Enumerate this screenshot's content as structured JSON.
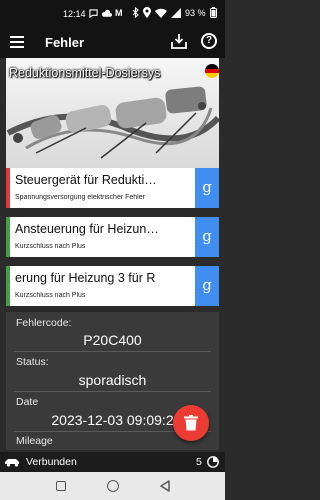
{
  "status_bar": {
    "time": "12:14",
    "battery": "93 %",
    "icons": [
      "chat-icon",
      "cloud-icon",
      "gmail-icon",
      "bluetooth-icon",
      "location-icon",
      "wifi-icon",
      "signal-icon",
      "battery-icon"
    ]
  },
  "app_bar": {
    "title": "Fehler",
    "icons": [
      "menu-icon",
      "download-icon",
      "help-icon"
    ]
  },
  "hero": {
    "title": "Reduktionsmittel-Dosiersys"
  },
  "fault_cards": [
    {
      "title": "Steuergerät für Redukti…",
      "subtitle": "Spannungsversorgung elektrischer Fehler",
      "accent": "#e53935",
      "action": "g"
    },
    {
      "title": "Ansteuerung für Heizun…",
      "subtitle": "Kurzschluss nach Plus",
      "accent": "#43a047",
      "action": "g"
    },
    {
      "title": "erung für Heizung 3 für R",
      "subtitle": "Kurzschluss nach Plus",
      "accent": "#43a047",
      "action": "g"
    }
  ],
  "detail": {
    "code_label": "Fehlercode:",
    "code_value": "P20C400",
    "status_label": "Status:",
    "status_value": "sporadisch",
    "date_label": "Date",
    "date_value": "2023-12-03 09:09:2",
    "mileage_label": "Mileage"
  },
  "bottom_bar": {
    "connection": "Verbunden",
    "count": "5"
  },
  "colors": {
    "background": "#2b2b2b",
    "bar": "#131313",
    "action_button": "#3f8ef0",
    "fab": "#ec3b33",
    "error_accent": "#e53935",
    "ok_accent": "#43a047"
  }
}
